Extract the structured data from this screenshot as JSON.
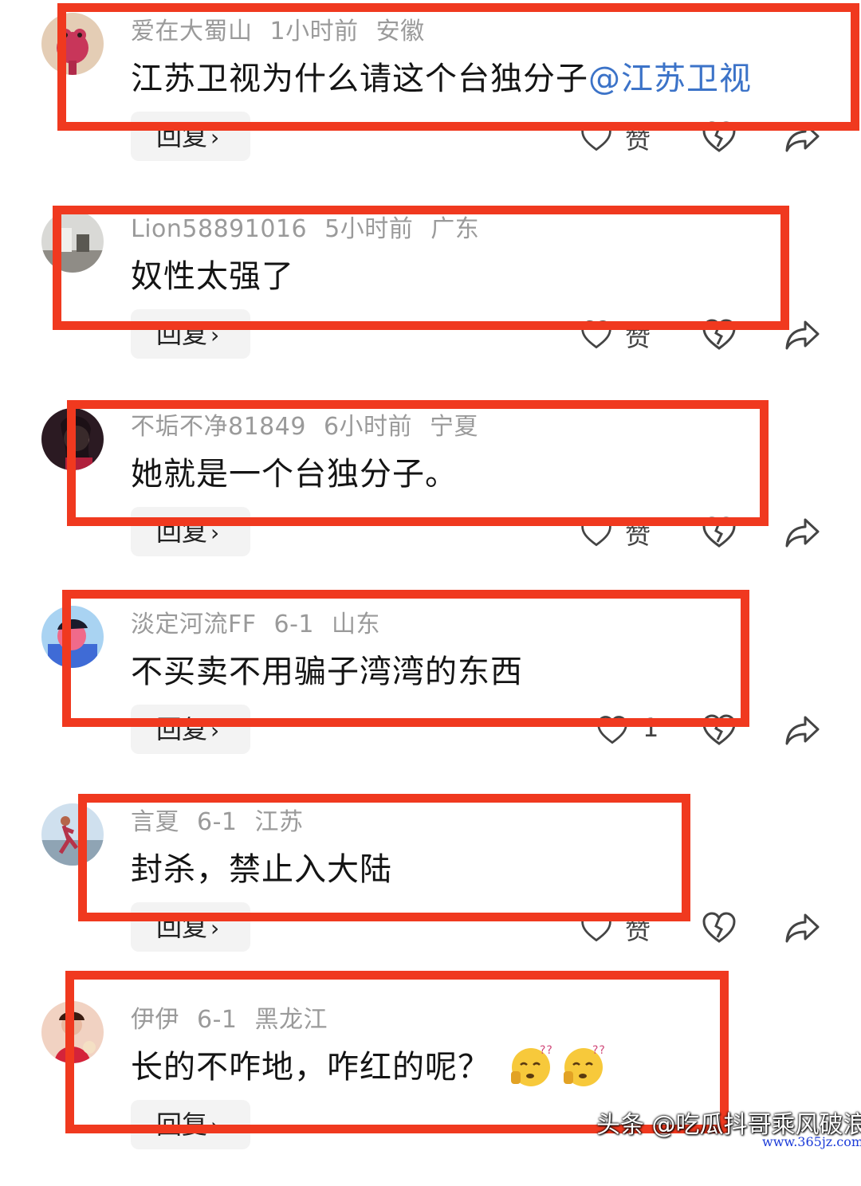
{
  "comments": [
    {
      "username": "爱在大蜀山",
      "time": "1小时前",
      "location": "安徽",
      "text": "江苏卫视为什么请这个台独分子",
      "mention": "@江苏卫视",
      "reply_label": "回复",
      "like_label": "赞",
      "avatar": "frog-avatar"
    },
    {
      "username": "Lion58891016",
      "time": "5小时前",
      "location": "广东",
      "text": "奴性太强了",
      "reply_label": "回复",
      "like_label": "赞",
      "avatar": "room-avatar"
    },
    {
      "username": "不垢不净81849",
      "time": "6小时前",
      "location": "宁夏",
      "text": "她就是一个台独分子。",
      "reply_label": "回复",
      "like_label": "赞",
      "avatar": "woman-portrait-avatar"
    },
    {
      "username": "淡定河流FF",
      "time": "6-1",
      "location": "山东",
      "text": "不买卖不用骗子湾湾的东西",
      "reply_label": "回复",
      "like_label": "1",
      "avatar": "cartoon-avatar"
    },
    {
      "username": "言夏",
      "time": "6-1",
      "location": "江苏",
      "text": "封杀，禁止入大陆",
      "reply_label": "回复",
      "like_label": "赞",
      "avatar": "runner-avatar"
    },
    {
      "username": "伊伊",
      "time": "6-1",
      "location": "黑龙江",
      "text": "长的不咋地，咋红的呢？",
      "emoji_count": 2,
      "emoji": "confused-face-emoji",
      "reply_label": "回复",
      "like_label": "赞",
      "avatar": "red-dress-avatar"
    }
  ],
  "watermark": {
    "text": "头条 @吃瓜抖哥乘风破浪",
    "site": "www.365jz.com"
  },
  "colors": {
    "highlight": "#f0391f",
    "mention": "#3c73c8",
    "meta": "#9a9a9a"
  }
}
